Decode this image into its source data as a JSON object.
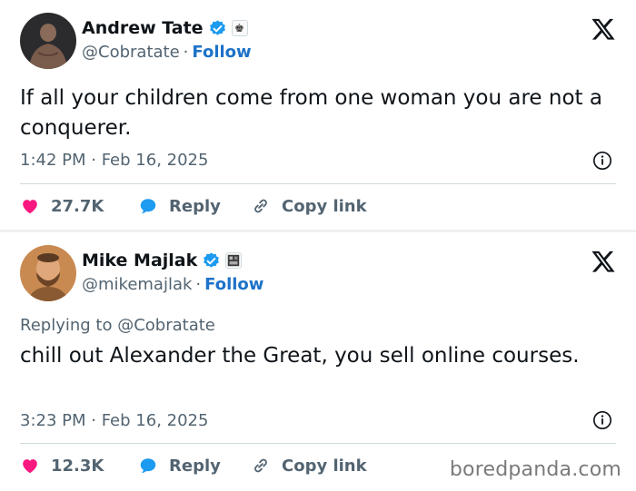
{
  "colors": {
    "accent_blue": "#1d72c8",
    "like_red": "#f91880",
    "reply_blue": "#1d9bf0",
    "muted_text": "#536471",
    "verified_blue": "#1d9bf0"
  },
  "tweets": [
    {
      "author_name": "Andrew Tate",
      "handle": "@Cobratate",
      "separator": "·",
      "follow_label": "Follow",
      "badge_icon": "chess-king-icon",
      "text": "If all your children come from one woman you are not a conquerer.",
      "time": "1:42 PM · Feb 16, 2025",
      "likes": "27.7K",
      "reply_label": "Reply",
      "copy_label": "Copy link"
    },
    {
      "author_name": "Mike Majlak",
      "handle": "@mikemajlak",
      "separator": "·",
      "follow_label": "Follow",
      "badge_icon": "image-badge-icon",
      "replying_prefix": "Replying to",
      "replying_to": "@Cobratate",
      "text": "chill out Alexander the Great, you sell online courses.",
      "time": "3:23 PM · Feb 16, 2025",
      "likes": "12.3K",
      "reply_label": "Reply",
      "copy_label": "Copy link"
    }
  ],
  "watermark": "boredpanda.com"
}
